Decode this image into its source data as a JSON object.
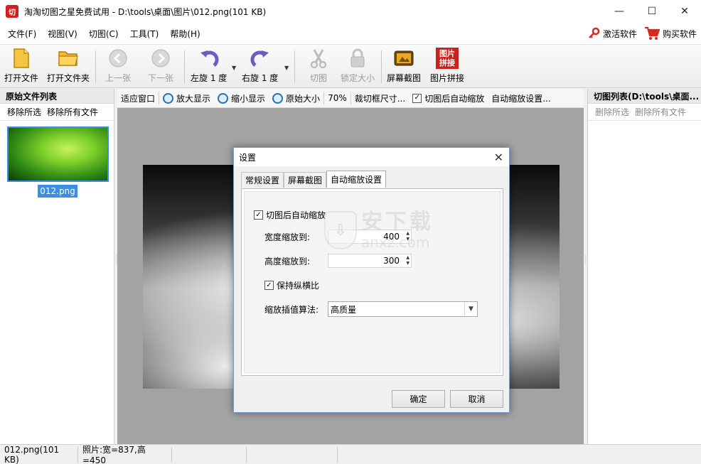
{
  "window": {
    "title": "淘淘切图之星免费试用 - D:\\tools\\桌面\\图片\\012.png(101 KB)",
    "logo_text": "切",
    "minimize": "—",
    "maximize": "☐",
    "close": "✕"
  },
  "menu": {
    "items": [
      "文件(F)",
      "视图(V)",
      "切图(C)",
      "工具(T)",
      "帮助(H)"
    ],
    "activate_label": "激活软件",
    "buy_label": "购买软件"
  },
  "toolbar": {
    "open_file": "打开文件",
    "open_folder": "打开文件夹",
    "prev": "上一张",
    "next": "下一张",
    "rotate_left": "左旋 1 度",
    "rotate_right": "右旋 1 度",
    "cut": "切图",
    "lock_size": "锁定大小",
    "screenshot": "屏幕截图",
    "stitch": "图片拼接",
    "stitch_icon_text": "图片\n拼接"
  },
  "left_panel": {
    "title": "原始文件列表",
    "remove_selected": "移除所选",
    "remove_all": "移除所有文件",
    "file_label": "012.png"
  },
  "view_toolbar": {
    "fit_window": "适应窗口",
    "zoom_in": "放大显示",
    "zoom_out": "缩小显示",
    "original_size": "原始大小",
    "zoom_level": "70%",
    "crop_size": "裁切框尺寸...",
    "auto_zoom_after_cut": "切图后自动缩放",
    "auto_zoom_settings": "自动缩放设置..."
  },
  "right_panel": {
    "title": "切图列表(D:\\tools\\桌面...",
    "delete_selected": "删除所选",
    "delete_all": "删除所有文件"
  },
  "status": {
    "file": "012.png(101 KB)",
    "dimensions": "照片:宽=837,高=450"
  },
  "dialog": {
    "title": "设置",
    "tabs": [
      "常规设置",
      "屏幕截图",
      "自动缩放设置"
    ],
    "active_tab": 2,
    "auto_zoom_checkbox": "切图后自动缩放",
    "width_label": "宽度缩放到:",
    "width_value": "400",
    "height_label": "高度缩放到:",
    "height_value": "300",
    "keep_ratio": "保持纵横比",
    "algorithm_label": "缩放插值算法:",
    "algorithm_value": "高质量",
    "ok": "确定",
    "cancel": "取消"
  },
  "watermark": {
    "cn": "安下载",
    "en": "anxz.com"
  }
}
